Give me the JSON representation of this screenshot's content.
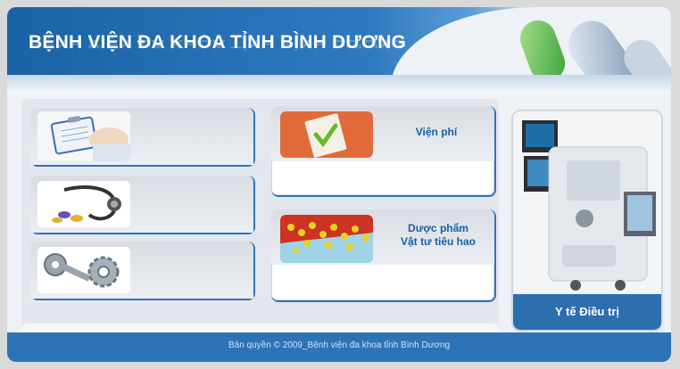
{
  "header": {
    "title": "BỆNH VIỆN ĐA KHOA TỈNH BÌNH DƯƠNG"
  },
  "menu": [
    {
      "id": "clipboard",
      "label": ""
    },
    {
      "id": "stethoscope",
      "label": ""
    },
    {
      "id": "keys-gears",
      "label": ""
    },
    {
      "id": "vien-phi",
      "label": "Viện phí"
    },
    {
      "id": "duoc-pham",
      "label": "Dược phẩm",
      "label2": "Vật tư tiêu hao"
    }
  ],
  "side": {
    "label": "Y tế Điều trị"
  },
  "footer": {
    "copyright": "Bản quyền © 2009_Bệnh viện đa khoa tỉnh Bình Dương"
  },
  "colors": {
    "brand_blue": "#2d74b6",
    "label_blue": "#1b5ea6",
    "accent_orange": "#e06a3a"
  }
}
